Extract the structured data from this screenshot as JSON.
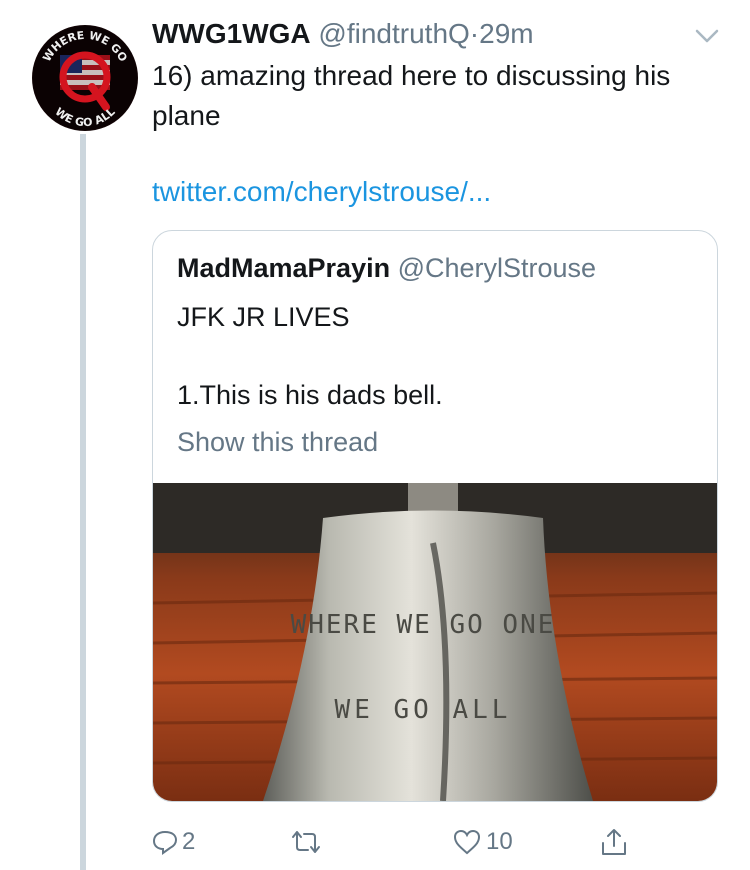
{
  "tweet": {
    "display_name": "WWG1WGA",
    "handle": "@findtruthQ",
    "separator": "·",
    "time": "29m",
    "text": "16) amazing thread here to discussing his plane",
    "link": "twitter.com/cherylstrouse/...",
    "avatar_text_top": "WHERE WE GO",
    "avatar_text_bottom": "WE GO ALL",
    "avatar_letter": "Q"
  },
  "quoted": {
    "display_name": "MadMamaPrayin",
    "handle": "@CherylStrouse",
    "line1": "JFK JR LIVES",
    "line2": "1.This is his dads bell.",
    "show_thread": "Show this thread",
    "image_text_1": "WHERE WE GO ONE",
    "image_text_2": "WE GO ALL"
  },
  "actions": {
    "reply_count": "2",
    "retweet_count": "",
    "like_count": "10"
  },
  "icons": {
    "reply": "reply-icon",
    "retweet": "retweet-icon",
    "like": "like-icon",
    "share": "share-icon",
    "more": "chevron-down-icon"
  },
  "colors": {
    "link": "#1b95e0",
    "secondary": "#657786",
    "border": "#ccd6dd"
  }
}
